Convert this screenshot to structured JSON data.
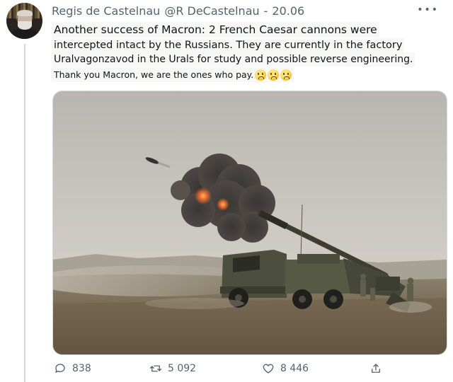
{
  "tweet": {
    "author": "Regis de Castelnau",
    "handle": "@R DeCastelnau",
    "separator": "-",
    "date": "20.06",
    "more_icon": "more-horizontal-icon",
    "text_lines": [
      "Another success of Macron: 2 French Caesar cannons were",
      "intercepted intact by the Russians. They are currently in the factory",
      "Uralvagonzavod in the Urals for study and possible reverse engineering.",
      "Thank you Macron, we are the ones who pay."
    ],
    "emojis": [
      "worried-face-emoji",
      "worried-face-emoji",
      "worried-face-emoji"
    ]
  },
  "actions": {
    "replies": "838",
    "retweets": "5 092",
    "likes": "8 446",
    "icons": {
      "reply": "reply-icon",
      "retweet": "retweet-icon",
      "like": "heart-icon",
      "share": "share-icon"
    }
  },
  "colors": {
    "text": "#0f1419",
    "muted": "#536471",
    "border": "#cfd9de"
  }
}
